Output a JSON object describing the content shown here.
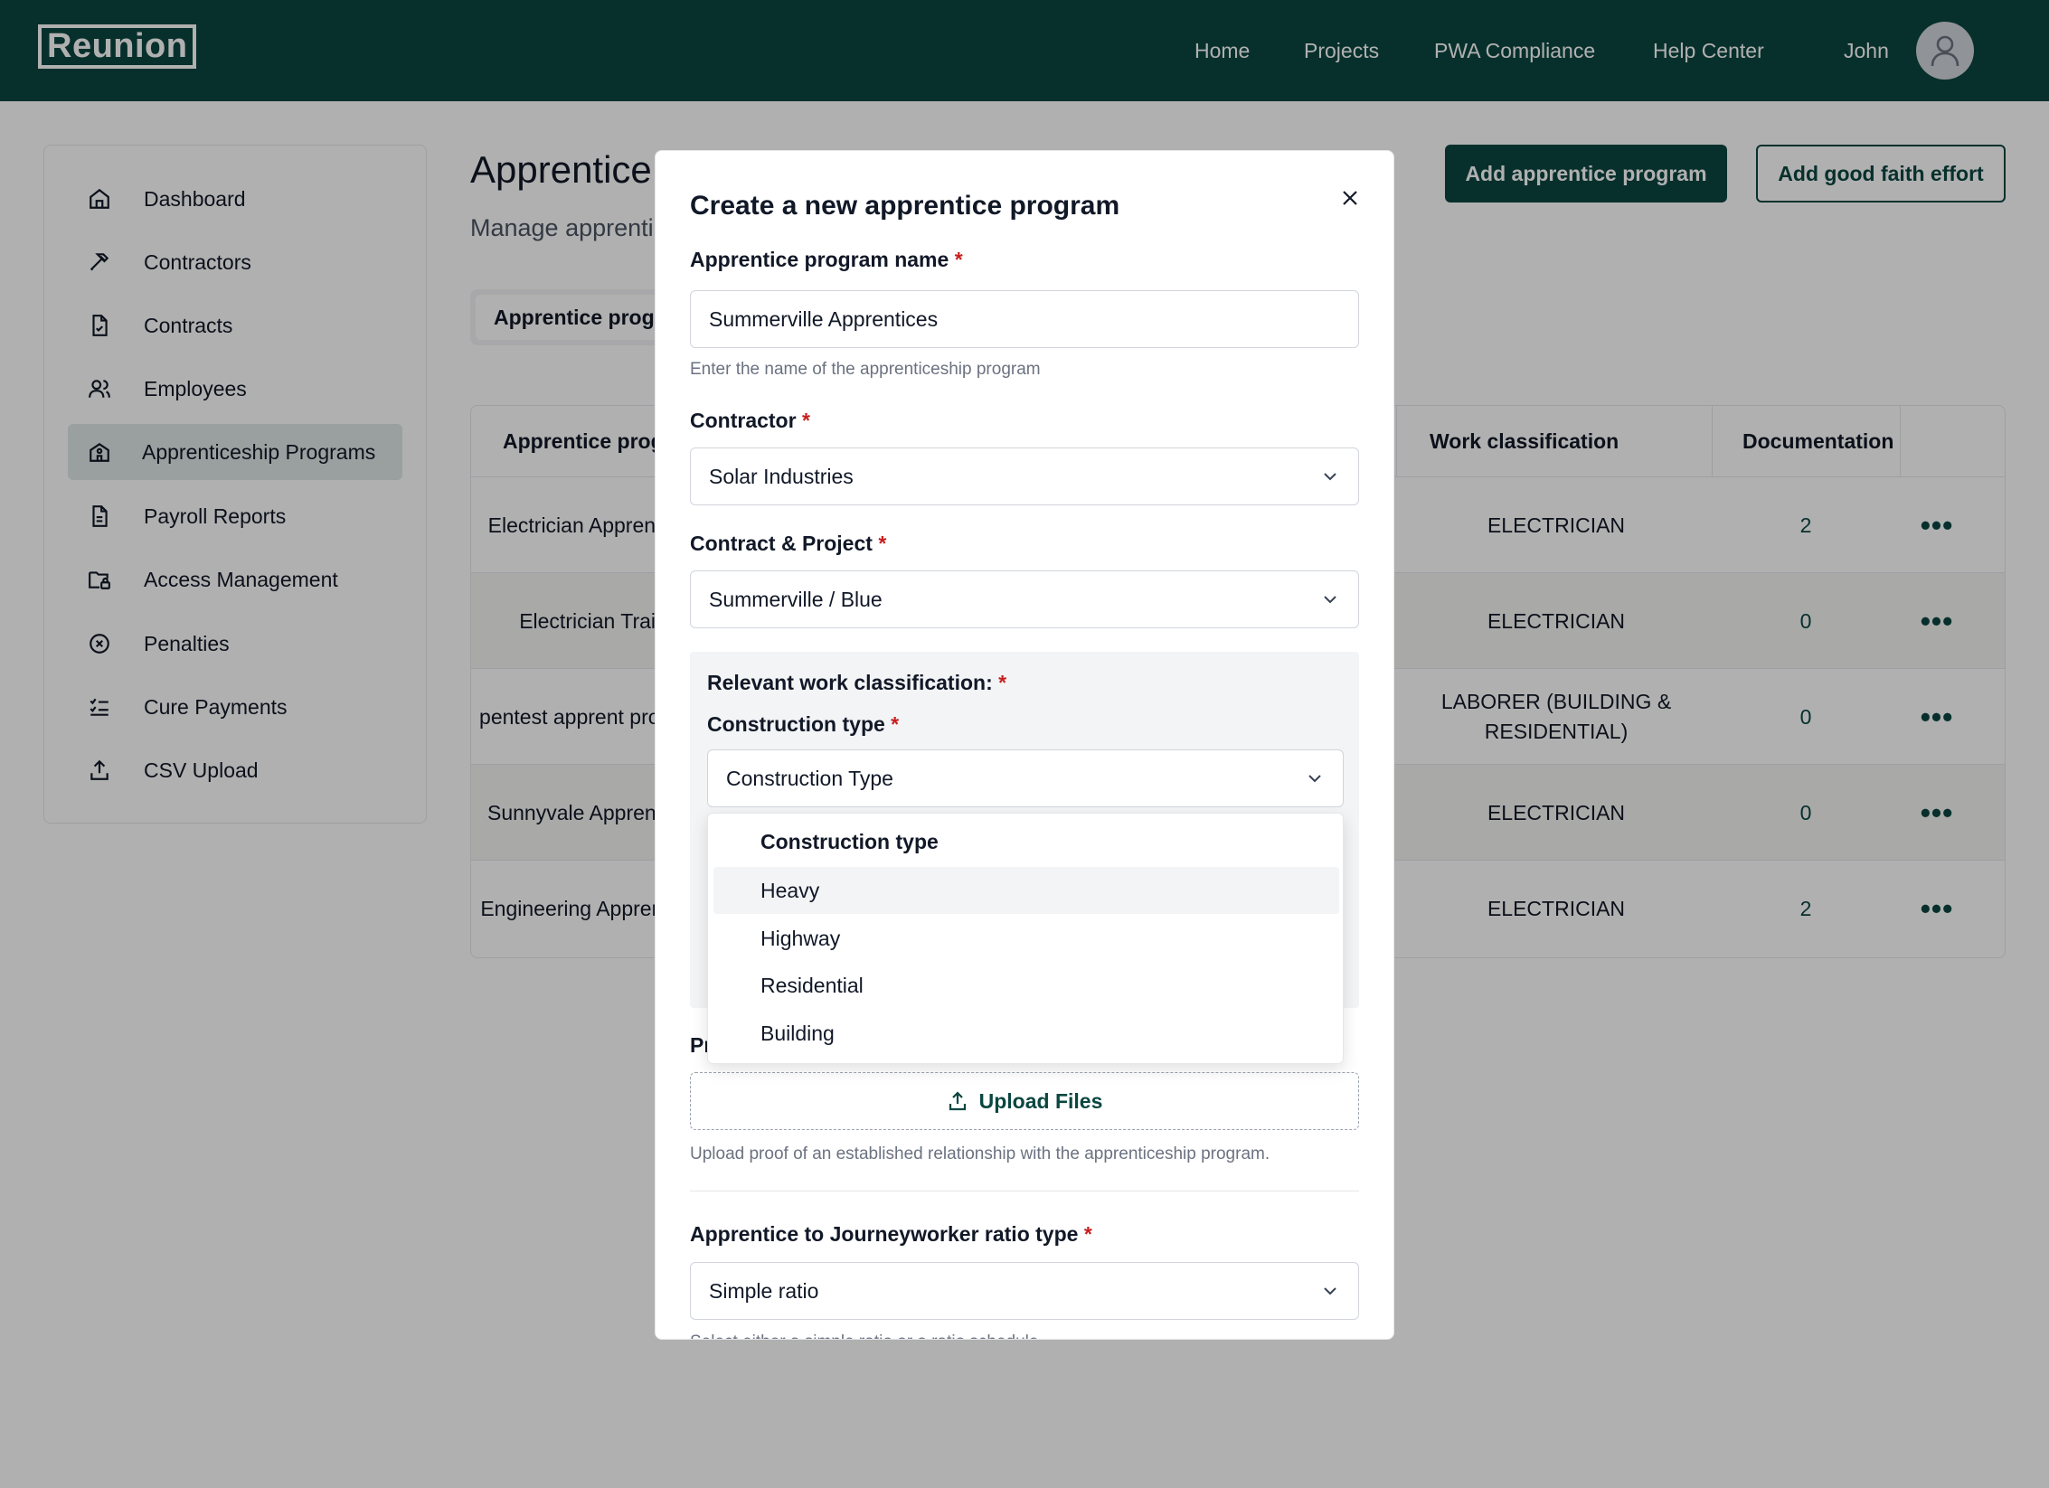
{
  "header": {
    "logo": "Reunion",
    "nav": [
      "Home",
      "Projects",
      "PWA Compliance",
      "Help Center"
    ],
    "user_name": "John"
  },
  "sidebar": {
    "items": [
      {
        "label": "Dashboard",
        "icon": "home-icon"
      },
      {
        "label": "Contractors",
        "icon": "hammer-icon"
      },
      {
        "label": "Contracts",
        "icon": "document-icon"
      },
      {
        "label": "Employees",
        "icon": "users-icon"
      },
      {
        "label": "Apprenticeship Programs",
        "icon": "school-icon",
        "active": true
      },
      {
        "label": "Payroll Reports",
        "icon": "report-icon"
      },
      {
        "label": "Access Management",
        "icon": "folder-lock-icon"
      },
      {
        "label": "Penalties",
        "icon": "x-circle-icon"
      },
      {
        "label": "Cure Payments",
        "icon": "checklist-icon"
      },
      {
        "label": "CSV Upload",
        "icon": "upload-icon"
      }
    ]
  },
  "main": {
    "title": "Apprentice",
    "subtitle": "Manage apprenti",
    "tab": "Apprentice progr",
    "add_program_button": "Add apprentice program",
    "add_gfe_button": "Add good faith effort",
    "table": {
      "headers": {
        "name": "Apprentice prog",
        "classification": "Work classification",
        "documentation": "Documentation"
      },
      "rows": [
        {
          "name": "Electrician Apprentices",
          "classification": "ELECTRICIAN",
          "docs": "2"
        },
        {
          "name": "Electrician Train",
          "classification": "ELECTRICIAN",
          "docs": "0"
        },
        {
          "name": "pentest apprent program",
          "classification": "LABORER (BUILDING & RESIDENTIAL)",
          "docs": "0"
        },
        {
          "name": "Sunnyvale Apprentices",
          "classification": "ELECTRICIAN",
          "docs": "0"
        },
        {
          "name": "Engineering Apprentices",
          "classification": "ELECTRICIAN",
          "docs": "2"
        }
      ],
      "more_label": "•••"
    }
  },
  "modal": {
    "title": "Create a new apprentice program",
    "program_name": {
      "label": "Apprentice program name",
      "value": "Summerville Apprentices",
      "help": "Enter the name of the apprenticeship program"
    },
    "contractor": {
      "label": "Contractor",
      "value": "Solar Industries"
    },
    "contract_project": {
      "label": "Contract & Project",
      "value": "Summerville / Blue"
    },
    "work_classification": {
      "label": "Relevant work classification:"
    },
    "construction_type": {
      "label": "Construction type",
      "value": "Construction Type",
      "options_header": "Construction type",
      "options": [
        "Heavy",
        "Highway",
        "Residential",
        "Building"
      ],
      "highlighted": "Heavy"
    },
    "proof": {
      "label_partial": "Pr",
      "upload_label": "Upload Files",
      "help": "Upload proof of an established relationship with the apprenticeship program."
    },
    "ratio_type": {
      "label": "Apprentice to Journeyworker ratio type",
      "value": "Simple ratio",
      "help": "Select either a simple ratio or a ratio schedule"
    },
    "required_mark": "*"
  },
  "colors": {
    "brand": "#0b4641",
    "required": "#c81e1e",
    "overlay": "rgba(0,0,0,0.31)"
  }
}
